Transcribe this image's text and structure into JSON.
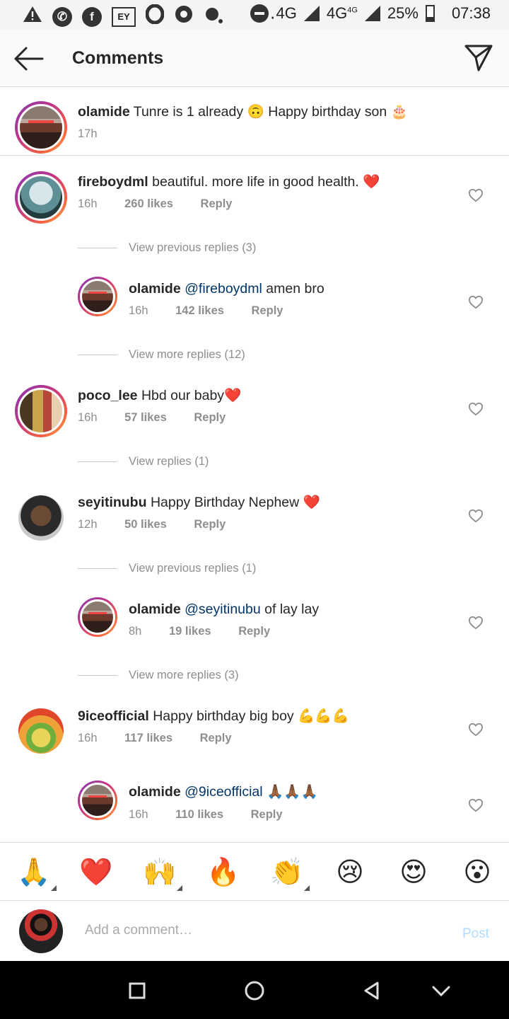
{
  "status_bar": {
    "left_icons": [
      "warning-icon",
      "whatsapp-icon",
      "facebook-icon",
      "ey-icon",
      "opera-icon",
      "chrome-icon",
      "notification-icon"
    ],
    "ey_label": "EY",
    "dots": "···",
    "network1": "4G",
    "network2": "4G",
    "network2_sup": "4G",
    "battery": "25%",
    "time": "07:38"
  },
  "header": {
    "title": "Comments"
  },
  "caption": {
    "username": "olamide",
    "text": "Tunre is 1 already 🙃 Happy birthday son 🎂",
    "time": "17h"
  },
  "comments": [
    {
      "username": "fireboydml",
      "text": "beautiful. more life in good health. ❤️",
      "time": "16h",
      "likes": "260 likes",
      "reply": "Reply"
    },
    {
      "username": "olamide",
      "mention": "@fireboydml",
      "text": "amen bro",
      "time": "16h",
      "likes": "142 likes",
      "reply": "Reply"
    },
    {
      "username": "poco_lee",
      "text": "Hbd our baby❤️",
      "time": "16h",
      "likes": "57 likes",
      "reply": "Reply"
    },
    {
      "username": "seyitinubu",
      "text": "Happy Birthday Nephew ❤️",
      "time": "12h",
      "likes": "50 likes",
      "reply": "Reply"
    },
    {
      "username": "olamide",
      "mention": "@seyitinubu",
      "text": "of lay lay",
      "time": "8h",
      "likes": "19 likes",
      "reply": "Reply"
    },
    {
      "username": "9iceofficial",
      "text": "Happy birthday big boy 💪💪💪",
      "time": "16h",
      "likes": "117 likes",
      "reply": "Reply"
    },
    {
      "username": "olamide",
      "mention": "@9iceofficial",
      "text": "🙏🏾🙏🏾🙏🏾",
      "time": "16h",
      "likes": "110 likes",
      "reply": "Reply"
    }
  ],
  "view_links": {
    "v1": "View previous replies (3)",
    "v2": "View more replies (12)",
    "v3": "View replies (1)",
    "v4": "View previous replies (1)",
    "v5": "View more replies (3)"
  },
  "emoji_bar": [
    "🙏",
    "❤️",
    "🙌",
    "🔥",
    "👏",
    "😢",
    "😍",
    "😮"
  ],
  "input": {
    "placeholder": "Add a comment…",
    "value": "",
    "post_label": "Post"
  },
  "colors": {
    "mention": "#003569",
    "post_disabled": "#b3dbff",
    "meta": "#8e8e8e"
  }
}
